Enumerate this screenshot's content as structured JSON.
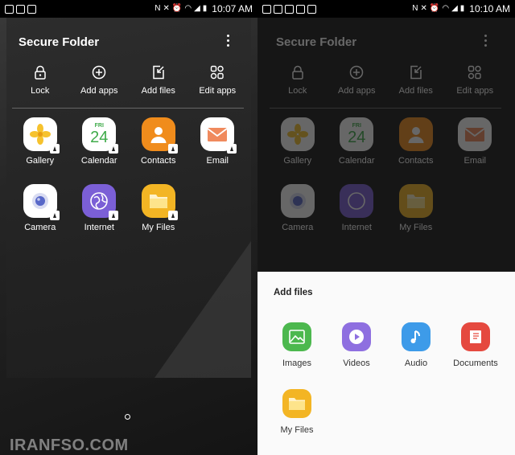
{
  "left": {
    "status": {
      "time": "10:07 AM"
    },
    "title": "Secure Folder",
    "actions": [
      {
        "label": "Lock",
        "icon": "lock-icon"
      },
      {
        "label": "Add apps",
        "icon": "add-circle-icon"
      },
      {
        "label": "Add files",
        "icon": "add-files-icon"
      },
      {
        "label": "Edit apps",
        "icon": "edit-apps-icon"
      }
    ],
    "apps": [
      {
        "label": "Gallery",
        "icon": "gallery-icon"
      },
      {
        "label": "Calendar",
        "icon": "calendar-icon",
        "month": "FRI",
        "day": "24"
      },
      {
        "label": "Contacts",
        "icon": "contacts-icon"
      },
      {
        "label": "Email",
        "icon": "email-icon"
      },
      {
        "label": "Camera",
        "icon": "camera-icon"
      },
      {
        "label": "Internet",
        "icon": "internet-icon"
      },
      {
        "label": "My Files",
        "icon": "folder-icon"
      }
    ],
    "watermark": "IRANFSO.COM"
  },
  "right": {
    "status": {
      "time": "10:10 AM"
    },
    "sheet": {
      "title": "Add files",
      "items": [
        {
          "label": "Images",
          "icon": "images-icon",
          "color": "#4cb84e"
        },
        {
          "label": "Videos",
          "icon": "videos-icon",
          "color": "#8e6fe0"
        },
        {
          "label": "Audio",
          "icon": "audio-icon",
          "color": "#3d9be9"
        },
        {
          "label": "Documents",
          "icon": "documents-icon",
          "color": "#e5493f"
        },
        {
          "label": "My Files",
          "icon": "folder-icon",
          "color": "#f3b524"
        }
      ]
    }
  },
  "colors": {
    "gallery": "#f6c22d",
    "calendar": "#3fab4a",
    "contacts": "#f08c1c",
    "email": "#f08a5d",
    "camera": "#5868c8",
    "internet": "#7b5fd6",
    "myfiles": "#f3b524"
  }
}
